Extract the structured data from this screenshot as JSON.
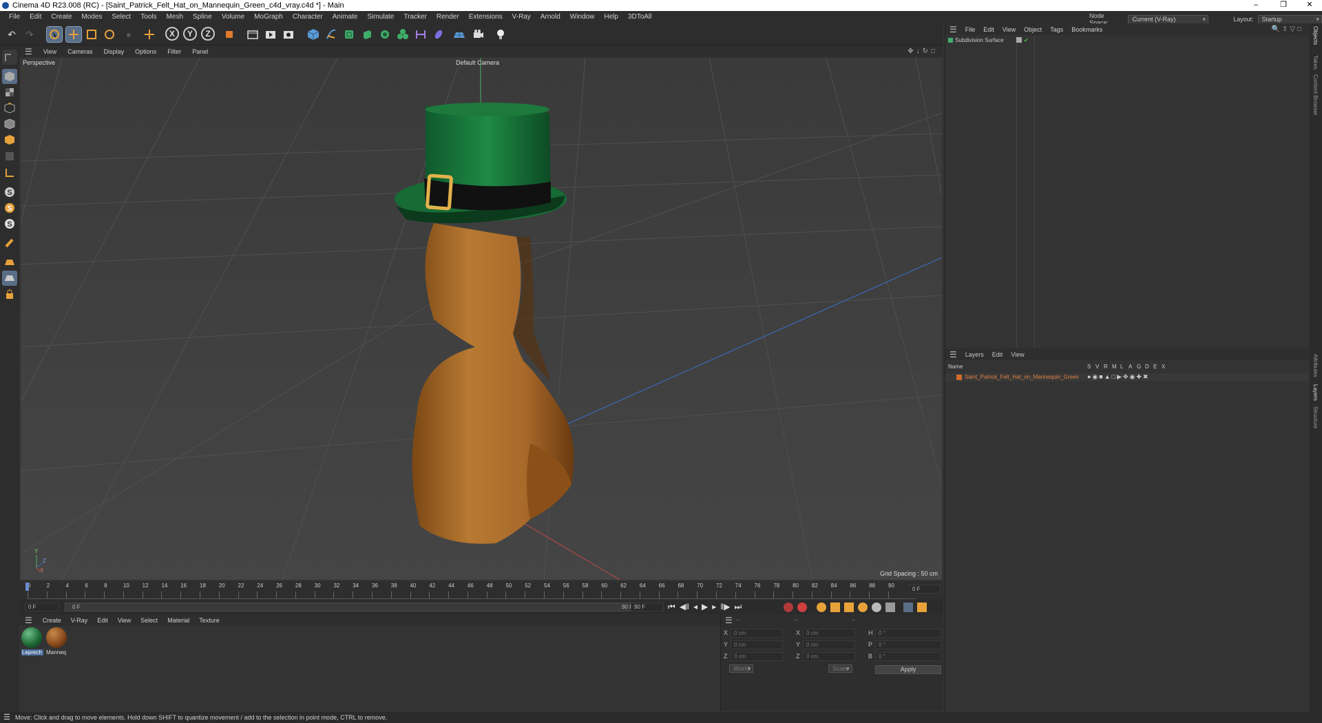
{
  "window": {
    "title": "Cinema 4D R23.008 (RC) - [Saint_Patrick_Felt_Hat_on_Mannequin_Green_c4d_vray.c4d *] - Main",
    "minimize": "–",
    "restore": "❐",
    "close": "✕"
  },
  "menubar": {
    "items": [
      "File",
      "Edit",
      "Create",
      "Modes",
      "Select",
      "Tools",
      "Mesh",
      "Spline",
      "Volume",
      "MoGraph",
      "Character",
      "Animate",
      "Simulate",
      "Tracker",
      "Render",
      "Extensions",
      "V-Ray",
      "Arnold",
      "Window",
      "Help",
      "3DToAll"
    ],
    "node_space_label": "Node Space:",
    "node_space_value": "Current (V-Ray)",
    "layout_label": "Layout:",
    "layout_value": "Startup"
  },
  "toolbar": {
    "axis_x": "X",
    "axis_y": "Y",
    "axis_z": "Z",
    "icons": [
      "undo-icon",
      "redo-icon",
      "select-icon",
      "move-icon",
      "scale-icon",
      "rotate-icon",
      "recent-icon",
      "add-icon",
      "x-axis-icon",
      "y-axis-icon",
      "z-axis-icon",
      "coordinate-system-icon",
      "render-region-icon",
      "render-view-icon",
      "render-settings-icon",
      "cube-icon",
      "pen-icon",
      "subdivision-icon",
      "extrude-icon",
      "array-icon",
      "mograph-icon",
      "deformer-icon",
      "field-icon",
      "floor-icon",
      "camera-icon",
      "light-icon"
    ]
  },
  "viewport": {
    "menu": [
      "View",
      "Cameras",
      "Display",
      "Options",
      "Filter",
      "Panel"
    ],
    "label": "Perspective",
    "camera": "Default Camera",
    "grid_spacing": "Grid Spacing : 50 cm",
    "axis_y": "Y",
    "axis_z": "Z",
    "axis_x": "X"
  },
  "timeline": {
    "ticks": [
      "0",
      "2",
      "4",
      "6",
      "8",
      "10",
      "12",
      "14",
      "16",
      "18",
      "20",
      "22",
      "24",
      "26",
      "28",
      "30",
      "32",
      "34",
      "36",
      "38",
      "40",
      "42",
      "44",
      "46",
      "48",
      "50",
      "52",
      "54",
      "56",
      "58",
      "60",
      "62",
      "64",
      "66",
      "68",
      "70",
      "72",
      "74",
      "76",
      "78",
      "80",
      "82",
      "84",
      "86",
      "88",
      "90"
    ],
    "current_frame": "0 F",
    "end_field": "0 F"
  },
  "transport": {
    "start_frame": "0 F",
    "range_start": "0 F",
    "range_end": "90 F",
    "end_frame": "90 F"
  },
  "materials": {
    "menu": [
      "Create",
      "V-Ray",
      "Edit",
      "View",
      "Select",
      "Material",
      "Texture"
    ],
    "items": [
      {
        "label": "Leprech",
        "color": "#1f6b38"
      },
      {
        "label": "Manneq",
        "color": "#8a4a1c"
      }
    ]
  },
  "coordinates": {
    "header": [
      "--",
      "--",
      "--"
    ],
    "pos_labels": [
      "X",
      "Y",
      "Z"
    ],
    "size_labels": [
      "X",
      "Y",
      "Z"
    ],
    "rot_labels": [
      "H",
      "P",
      "B"
    ],
    "pos_values": [
      "0 cm",
      "0 cm",
      "0 cm"
    ],
    "size_values": [
      "0 cm",
      "0 cm",
      "0 cm"
    ],
    "rot_values": [
      "0 °",
      "0 °",
      "0 °"
    ],
    "mode": "World",
    "size_mode": "Scale",
    "apply": "Apply"
  },
  "objects": {
    "menu": [
      "File",
      "Edit",
      "View",
      "Object",
      "Tags",
      "Bookmarks"
    ],
    "items": [
      {
        "name": "Subdivision Surface"
      }
    ]
  },
  "layers": {
    "menu": [
      "Layers",
      "Edit",
      "View"
    ],
    "name_header": "Name",
    "flag_headers": [
      "S",
      "V",
      "R",
      "M",
      "L",
      "A",
      "G",
      "D",
      "E",
      "X"
    ],
    "items": [
      {
        "name": "Saint_Patrick_Felt_Hat_on_Mannequin_Green",
        "color": "#d06a2a"
      }
    ]
  },
  "right_tabs": [
    "Objects",
    "Takes",
    "Content Browser",
    "Attributes",
    "Layers",
    "Structure"
  ],
  "status": "Move: Click and drag to move elements. Hold down SHIFT to quantize movement / add to the selection in point mode, CTRL to remove."
}
